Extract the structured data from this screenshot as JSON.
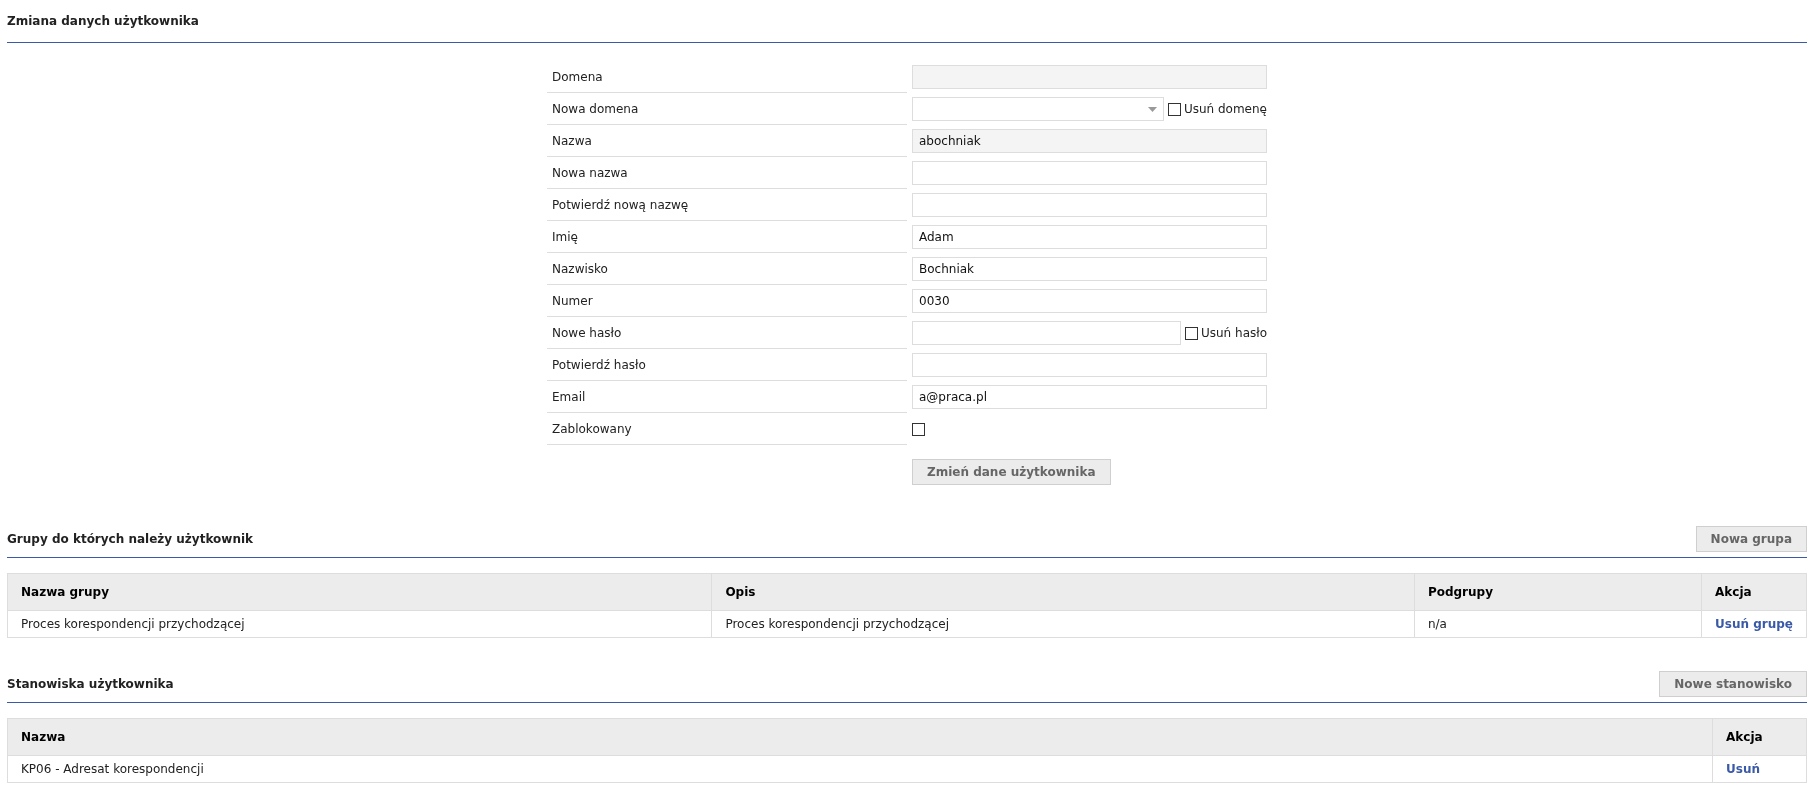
{
  "user_form": {
    "title": "Zmiana danych użytkownika",
    "fields": [
      {
        "label": "Domena",
        "kind": "readonly"
      },
      {
        "label": "Nowa domena",
        "kind": "select",
        "extra": {
          "label": "Usuń domenę",
          "checked": false
        }
      },
      {
        "label": "Nazwa",
        "kind": "readonly",
        "value": "abochniak"
      },
      {
        "label": "Nowa nazwa",
        "kind": "text"
      },
      {
        "label": "Potwierdź nową nazwę",
        "kind": "text"
      },
      {
        "label": "Imię",
        "kind": "text",
        "value": "Adam"
      },
      {
        "label": "Nazwisko",
        "kind": "text",
        "value": "Bochniak"
      },
      {
        "label": "Numer",
        "kind": "text",
        "value": "0030"
      },
      {
        "label": "Nowe hasło",
        "kind": "text",
        "extra": {
          "label": "Usuń hasło",
          "checked": false
        }
      },
      {
        "label": "Potwierdź hasło",
        "kind": "text"
      },
      {
        "label": "Email",
        "kind": "text",
        "value": "a@praca.pl"
      },
      {
        "label": "Zablokowany",
        "kind": "checkbox",
        "checked": false
      }
    ],
    "submit": "Zmień dane użytkownika"
  },
  "groups": {
    "title": "Grupy do których należy użytkownik",
    "button": "Nowa grupa",
    "table": {
      "columns": [
        "Nazwa grupy",
        "Opis",
        "Podgrupy",
        "Akcja"
      ],
      "rows": [
        {
          "cells": [
            "Proces korespondencji przychodzącej",
            "Proces korespondencji przychodzącej",
            "n/a"
          ],
          "action": "Usuń grupę"
        }
      ]
    }
  },
  "positions": {
    "title": "Stanowiska użytkownika",
    "button": "Nowe stanowisko",
    "table": {
      "columns": [
        "Nazwa",
        "Akcja"
      ],
      "rows": [
        {
          "cells": [
            "KP06 - Adresat korespondencji"
          ],
          "action": "Usuń"
        }
      ]
    }
  }
}
